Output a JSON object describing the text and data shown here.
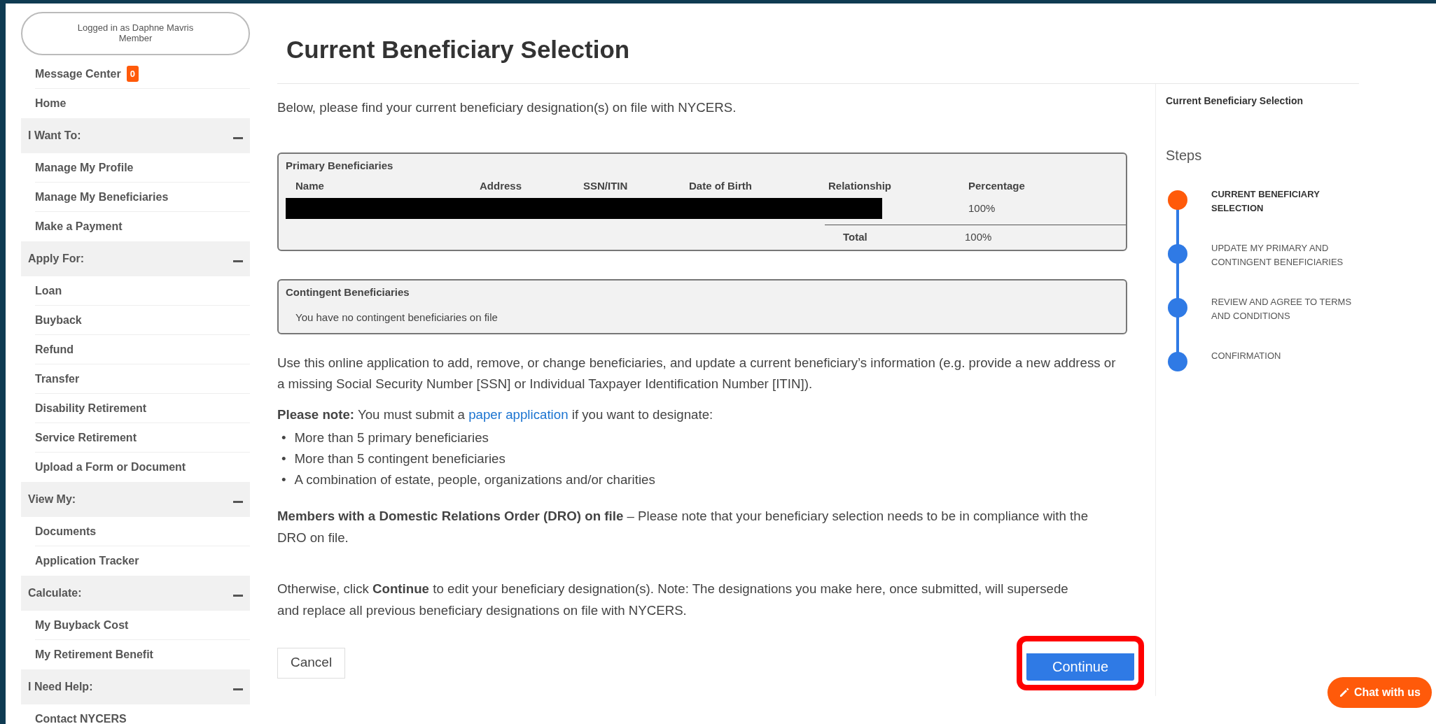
{
  "user_box": {
    "line1": "Logged in as Daphne Mavris",
    "line2": "Member"
  },
  "sidebar": [
    {
      "kind": "link",
      "label": "Message Center",
      "badge": "0"
    },
    {
      "kind": "link",
      "label": "Home"
    },
    {
      "kind": "section",
      "label": "I Want To:",
      "expanded": true,
      "children": [
        {
          "label": "Manage My Profile"
        },
        {
          "label": "Manage My Beneficiaries"
        },
        {
          "label": "Make a Payment"
        }
      ]
    },
    {
      "kind": "section",
      "label": "Apply For:",
      "expanded": true,
      "children": [
        {
          "label": "Loan"
        },
        {
          "label": "Buyback"
        },
        {
          "label": "Refund"
        },
        {
          "label": "Transfer"
        },
        {
          "label": "Disability Retirement"
        },
        {
          "label": "Service Retirement"
        },
        {
          "label": "Upload a Form or Document"
        }
      ]
    },
    {
      "kind": "section",
      "label": "View My:",
      "expanded": true,
      "children": [
        {
          "label": "Documents"
        },
        {
          "label": "Application Tracker"
        }
      ]
    },
    {
      "kind": "section",
      "label": "Calculate:",
      "expanded": true,
      "children": [
        {
          "label": "My Buyback Cost"
        },
        {
          "label": "My Retirement Benefit"
        }
      ]
    },
    {
      "kind": "section",
      "label": "I Need Help:",
      "expanded": true,
      "children": [
        {
          "label": "Contact NYCERS"
        }
      ]
    }
  ],
  "page_title": "Current Beneficiary Selection",
  "intro": "Below, please find your current beneficiary designation(s) on file with NYCERS.",
  "primary_beneficiaries": {
    "title": "Primary Beneficiaries",
    "columns": [
      "Name",
      "Address",
      "SSN/ITIN",
      "Date of Birth",
      "Relationship",
      "Percentage"
    ],
    "rows": [
      {
        "redacted": true,
        "percentage": "100%"
      }
    ],
    "total_label": "Total",
    "total_value": "100%"
  },
  "contingent_beneficiaries": {
    "title": "Contingent Beneficiaries",
    "empty_message": "You have no contingent beneficiaries on file"
  },
  "description": "Use this online application to add, remove, or change beneficiaries, and update a current beneficiary’s information (e.g. provide a new address or a missing Social Security Number [SSN] or Individual Taxpayer Identification Number [ITIN]).",
  "note": {
    "before": "**Please note:** You must submit a",
    "link": "paper application",
    "after": "if you want to designate:"
  },
  "bullets": [
    {
      "marker": "•",
      "text": "More than 5 primary beneficiaries"
    },
    {
      "marker": "•",
      "text": "More than 5 contingent beneficiaries"
    },
    {
      "marker": "•",
      "text": "A combination of estate, people, organizations and/or charities"
    }
  ],
  "dro_note": "**Members with a Domestic Relations Order (DRO) on file** – Please note that your beneficiary selection needs to be in compliance with the DRO on file.",
  "continue_note": "Otherwise, click **Continue** to edit your beneficiary designation(s). Note: The designations you make here, once submitted, will supersede and replace all previous beneficiary designations on file with NYCERS.",
  "buttons": [
    {
      "kind": "secondary",
      "label": "Cancel",
      "highlighted": false
    },
    {
      "kind": "primary",
      "label": "Continue",
      "highlighted": true
    }
  ],
  "progress_panel": {
    "title": "Current Beneficiary Selection",
    "steps_heading": "Steps",
    "steps": [
      {
        "label": "CURRENT BENEFICIARY SELECTION",
        "selected": true
      },
      {
        "label": "UPDATE MY PRIMARY AND CONTINGENT BENEFICIARIES",
        "selected": false
      },
      {
        "label": "REVIEW AND AGREE TO TERMS AND CONDITIONS",
        "selected": false
      },
      {
        "label": "CONFIRMATION",
        "selected": false
      }
    ]
  },
  "chat_button": {
    "label": "Chat with us"
  }
}
